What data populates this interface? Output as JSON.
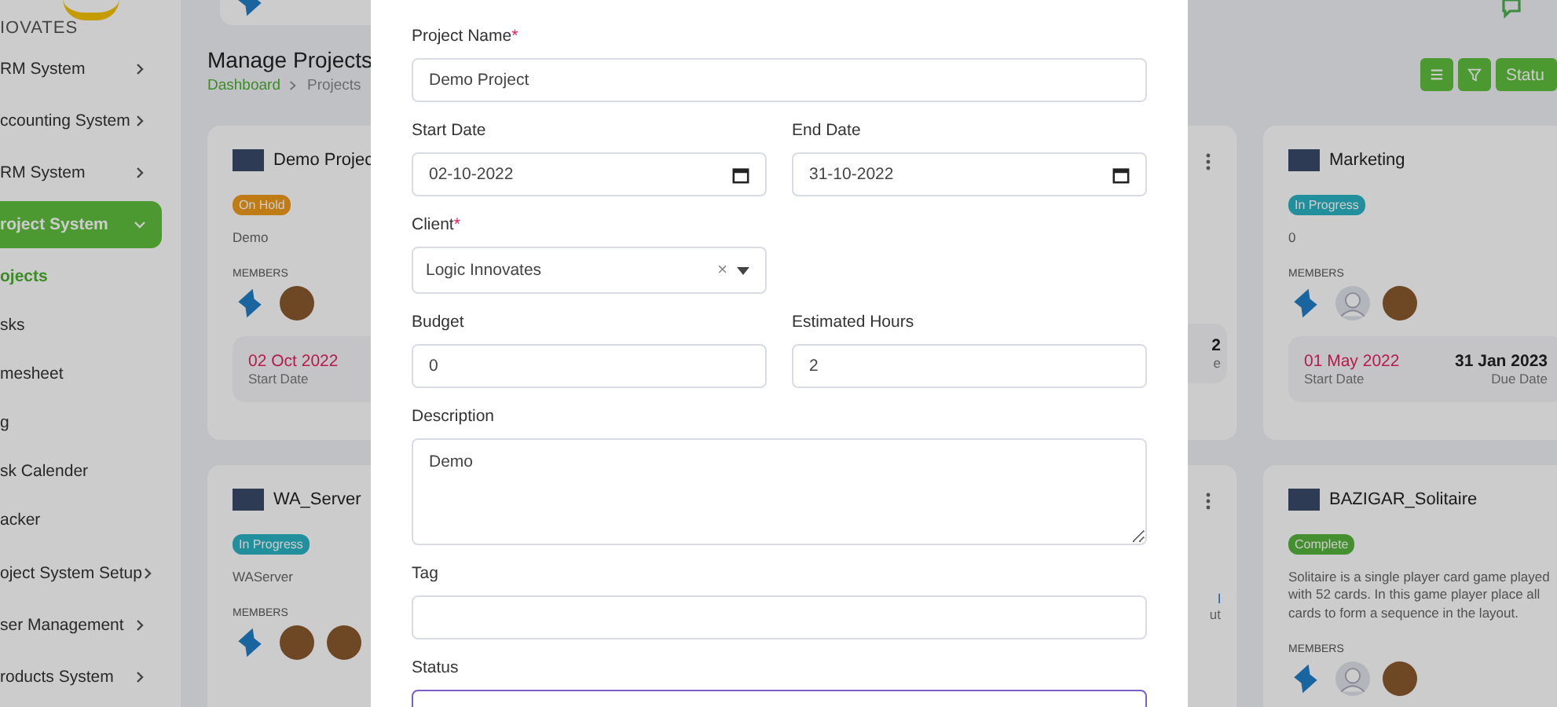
{
  "sidebar": {
    "logo_text": "IOVATES",
    "items": [
      {
        "label": "RM System",
        "selected": false,
        "expanded": false
      },
      {
        "label": "ccounting System",
        "selected": false,
        "expanded": false
      },
      {
        "label": "RM System",
        "selected": false,
        "expanded": false
      },
      {
        "label": "roject System",
        "selected": true,
        "expanded": true,
        "children": [
          {
            "label": "ojects",
            "selected": true
          },
          {
            "label": "sks",
            "selected": false
          },
          {
            "label": "mesheet",
            "selected": false
          },
          {
            "label": "g",
            "selected": false
          },
          {
            "label": "sk Calender",
            "selected": false
          },
          {
            "label": "acker",
            "selected": false
          }
        ]
      },
      {
        "label": "oject System Setup",
        "selected": false,
        "expanded": false
      },
      {
        "label": "ser Management",
        "selected": false,
        "expanded": false
      },
      {
        "label": "roducts System",
        "selected": false,
        "expanded": false
      }
    ]
  },
  "page": {
    "title": "Manage Projects",
    "breadcrumb": [
      "Dashboard",
      "Projects"
    ],
    "toolbar": [
      {
        "kind": "list"
      },
      {
        "kind": "filter"
      },
      {
        "kind": "text",
        "label": "Statu"
      }
    ]
  },
  "card_rows": [
    {
      "left": {
        "title": "Demo Projec",
        "status": {
          "label": "On Hold",
          "kind": "on_hold"
        },
        "description": "Demo",
        "members_label": "MEMBERS",
        "members": [
          {
            "kind": "logo"
          },
          {
            "kind": "photo"
          }
        ],
        "dates": {
          "start": "02 Oct 2022",
          "start_label": "Start Date"
        }
      },
      "partial": [
        "2",
        "e"
      ],
      "right": {
        "title": "Marketing",
        "status": {
          "label": "In Progress",
          "kind": "in_progress"
        },
        "description": "0",
        "members_label": "MEMBERS",
        "members": [
          {
            "kind": "logo"
          },
          {
            "kind": "default"
          },
          {
            "kind": "photo"
          }
        ],
        "dates": {
          "start": "01 May 2022",
          "start_label": "Start Date",
          "due": "31 Jan 2023",
          "due_label": "Due Date"
        }
      }
    },
    {
      "left": {
        "title": "WA_Server",
        "status": {
          "label": "In Progress",
          "kind": "in_progress"
        },
        "description": "WAServer",
        "members_label": "MEMBERS",
        "members": [
          {
            "kind": "logo"
          },
          {
            "kind": "photo"
          },
          {
            "kind": "photo"
          }
        ]
      },
      "partial": [
        "l",
        "ut"
      ],
      "right": {
        "title": "BAZIGAR_Solitaire",
        "status": {
          "label": "Complete",
          "kind": "complete"
        },
        "description": "Solitaire is a single player card game played with 52 cards. In this game player place all cards to form a sequence in the layout.",
        "members_label": "MEMBERS",
        "members": [
          {
            "kind": "logo"
          },
          {
            "kind": "default"
          },
          {
            "kind": "photo"
          }
        ]
      }
    }
  ],
  "modal": {
    "rows": [
      [
        {
          "kind": "text",
          "label": "Project Name",
          "required_mark": "*",
          "value": "Demo Project"
        }
      ],
      [
        {
          "kind": "date",
          "label": "Start Date",
          "value": "02-10-2022"
        },
        {
          "kind": "date",
          "label": "End Date",
          "value": "31-10-2022"
        }
      ],
      [
        {
          "kind": "select",
          "label": "Client",
          "required_mark": "*",
          "value": "Logic Innovates",
          "clear": "×"
        }
      ],
      [
        {
          "kind": "text",
          "label": "Budget",
          "value": "0"
        },
        {
          "kind": "text",
          "label": "Estimated Hours",
          "value": "2"
        }
      ],
      [
        {
          "kind": "textarea",
          "label": "Description",
          "value": "Demo"
        }
      ],
      [
        {
          "kind": "text",
          "label": "Tag"
        }
      ],
      [
        {
          "kind": "select",
          "label": "Status",
          "focused": true
        }
      ]
    ]
  }
}
